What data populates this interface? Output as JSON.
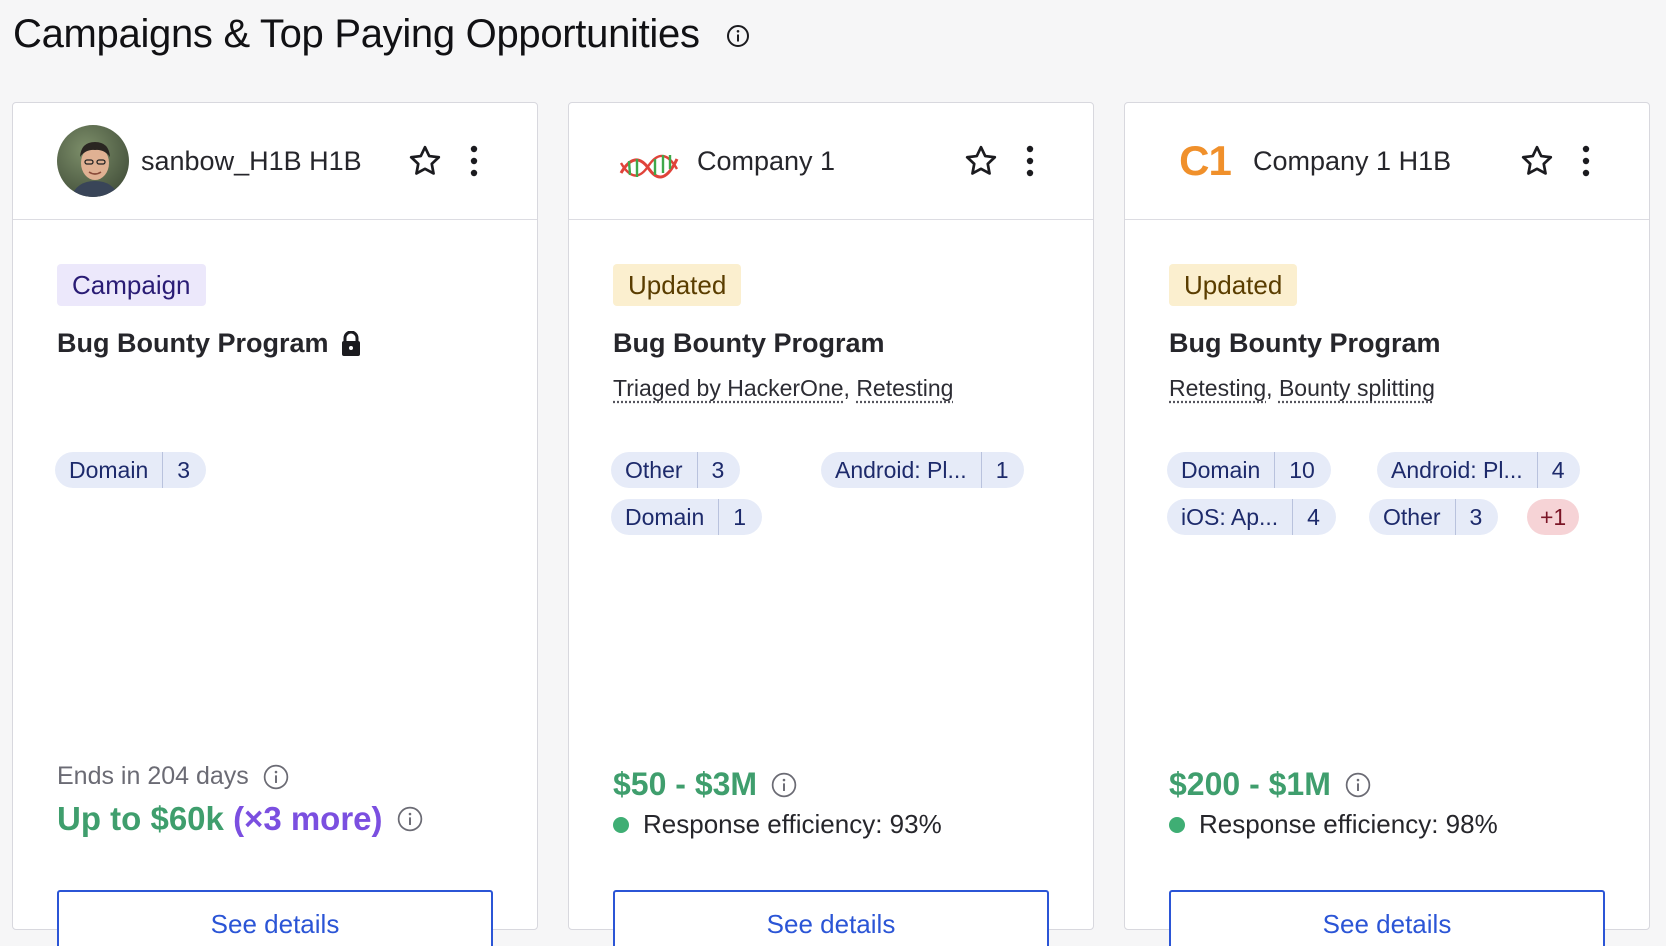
{
  "page": {
    "title": "Campaigns & Top Paying Opportunities",
    "colors": {
      "accent": "#2b55d6",
      "green": "#3f9e6d",
      "purple": "#7b4fe0",
      "c1_orange": "#f0902b",
      "campaign_badge_bg": "#ece8fb",
      "updated_badge_bg": "#fbefcf",
      "chip_bg": "#e6ebf8",
      "plus_chip_bg": "#f6d3d6"
    }
  },
  "cards": [
    {
      "company": "sanbow_H1B H1B",
      "logo": "avatar-photo",
      "badge": "Campaign",
      "program": "Bug Bounty Program",
      "program_icon": "lock-icon",
      "scope_chips": [
        {
          "label": "Domain",
          "count": "3"
        }
      ],
      "ends_text": "Ends in 204 days",
      "reward_text": "Up to $60k",
      "reward_multiplier": "(×3 more)",
      "button": "See details"
    },
    {
      "company": "Company 1",
      "logo": "dna-logo",
      "badge": "Updated",
      "program": "Bug Bounty Program",
      "features": [
        "Triaged by HackerOne",
        "Retesting"
      ],
      "scope_chips": [
        {
          "label": "Other",
          "count": "3"
        },
        {
          "label": "Android: Pl...",
          "count": "1"
        },
        {
          "label": "Domain",
          "count": "1"
        }
      ],
      "bounty_range": "$50 - $3M",
      "efficiency": "Response efficiency: 93%",
      "button": "See details"
    },
    {
      "company": "Company 1 H1B",
      "logo": "c1-logo",
      "logo_text": "C1",
      "badge": "Updated",
      "program": "Bug Bounty Program",
      "features": [
        "Retesting",
        "Bounty splitting"
      ],
      "scope_chips": [
        {
          "label": "Domain",
          "count": "10"
        },
        {
          "label": "Android: Pl...",
          "count": "4"
        },
        {
          "label": "iOS: Ap...",
          "count": "4"
        },
        {
          "label": "Other",
          "count": "3"
        }
      ],
      "extra_chip": "+1",
      "bounty_range": "$200 - $1M",
      "efficiency": "Response efficiency: 98%",
      "button": "See details"
    }
  ]
}
